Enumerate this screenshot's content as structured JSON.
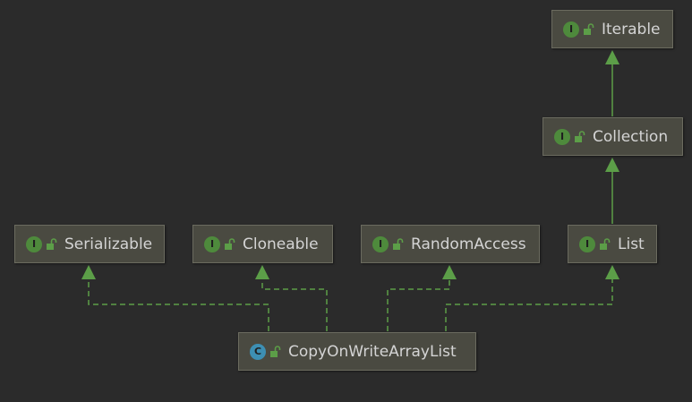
{
  "nodes": {
    "iterable": {
      "label": "Iterable",
      "kind": "interface",
      "badge": "I",
      "icon": "open-lock-icon"
    },
    "collection": {
      "label": "Collection",
      "kind": "interface",
      "badge": "I",
      "icon": "open-lock-icon"
    },
    "serializable": {
      "label": "Serializable",
      "kind": "interface",
      "badge": "I",
      "icon": "open-lock-icon"
    },
    "cloneable": {
      "label": "Cloneable",
      "kind": "interface",
      "badge": "I",
      "icon": "open-lock-icon"
    },
    "random_access": {
      "label": "RandomAccess",
      "kind": "interface",
      "badge": "I",
      "icon": "open-lock-icon"
    },
    "list": {
      "label": "List",
      "kind": "interface",
      "badge": "I",
      "icon": "open-lock-icon"
    },
    "copy_on_write_array_list": {
      "label": "CopyOnWriteArrayList",
      "kind": "class",
      "badge": "C",
      "icon": "open-lock-icon"
    }
  },
  "edges": [
    {
      "from": "collection",
      "to": "iterable",
      "type": "extends"
    },
    {
      "from": "list",
      "to": "collection",
      "type": "extends"
    },
    {
      "from": "copy_on_write_array_list",
      "to": "serializable",
      "type": "implements"
    },
    {
      "from": "copy_on_write_array_list",
      "to": "cloneable",
      "type": "implements"
    },
    {
      "from": "copy_on_write_array_list",
      "to": "random_access",
      "type": "implements"
    },
    {
      "from": "copy_on_write_array_list",
      "to": "list",
      "type": "implements"
    }
  ],
  "colors": {
    "background": "#2b2b2b",
    "node_fill": "#4a4a41",
    "node_border": "#6b6b5f",
    "edge": "#5c9e48",
    "interface_badge": "#4e8a3c",
    "class_badge": "#3d8fb3",
    "text": "#d4d4d4"
  }
}
